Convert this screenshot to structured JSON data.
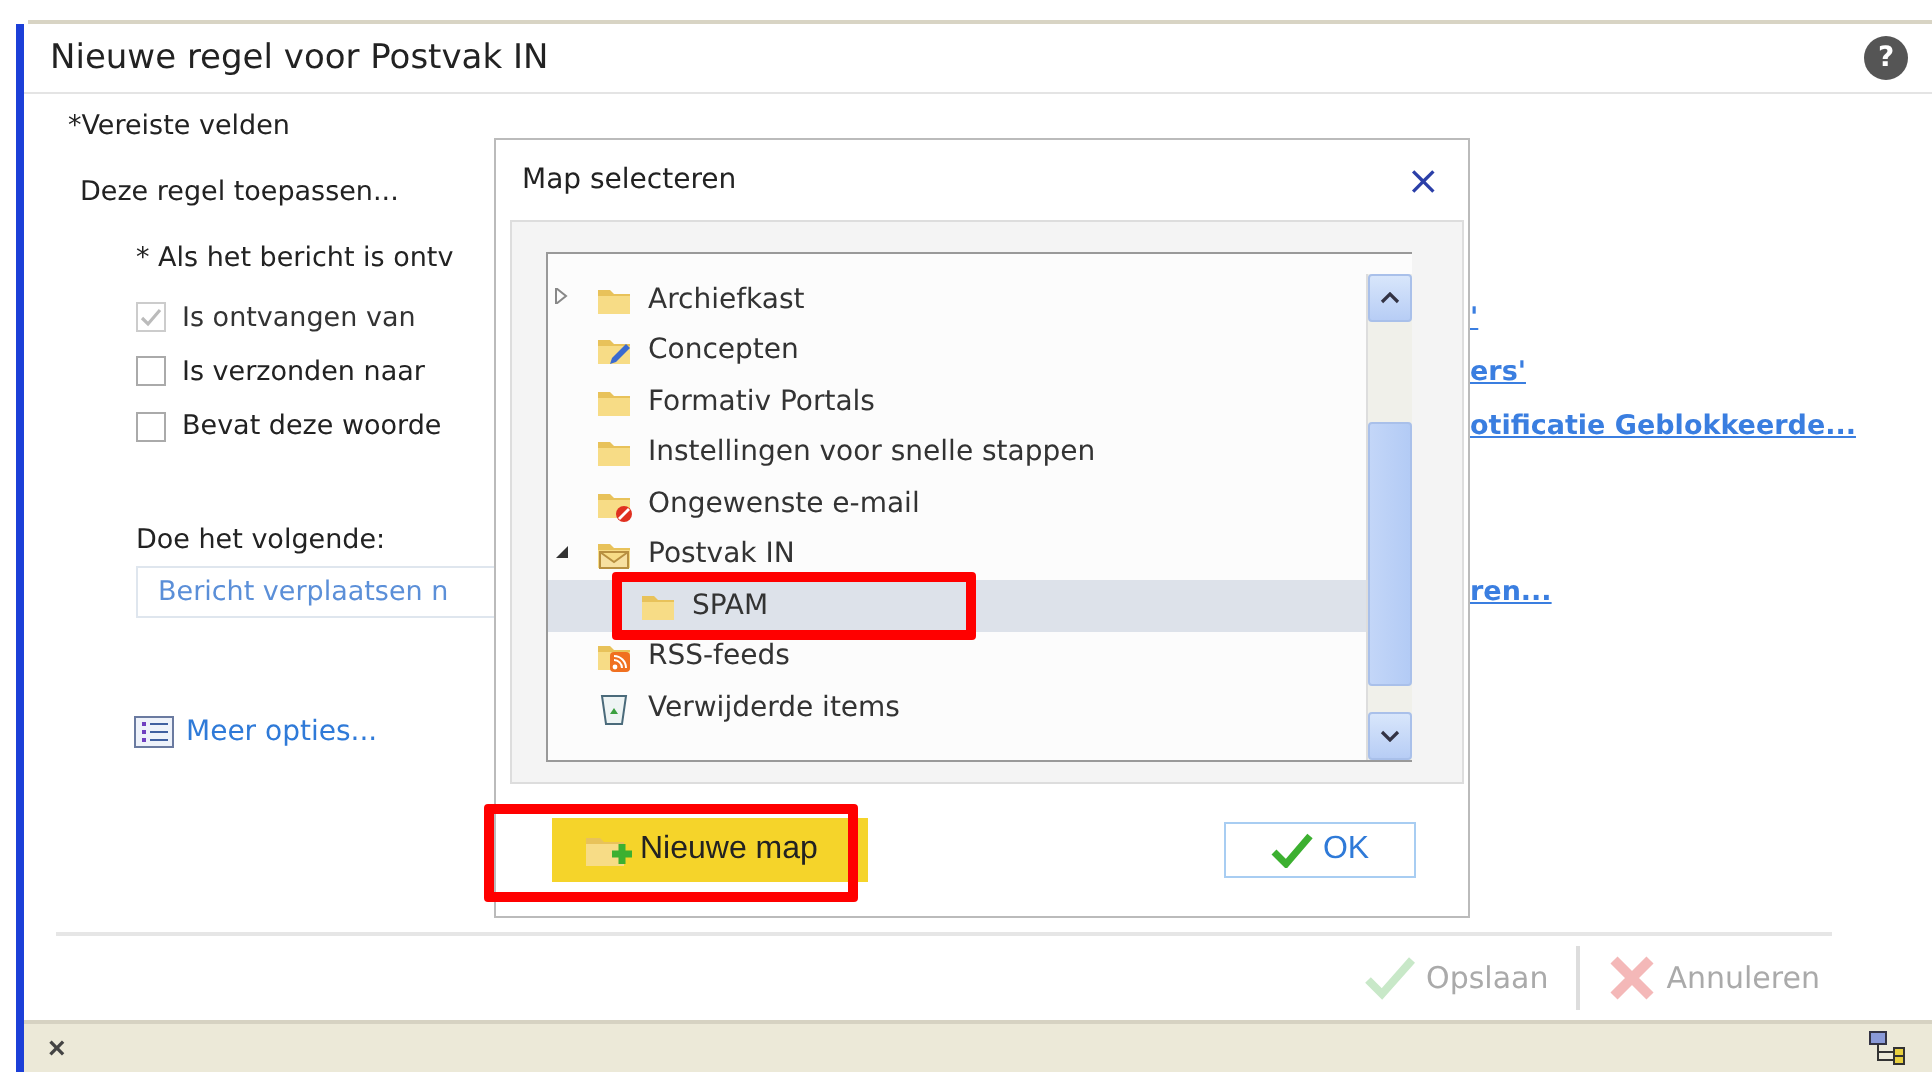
{
  "window": {
    "title": "Nieuwe regel voor Postvak IN",
    "help": "?"
  },
  "required_note": "*Vereiste velden",
  "apply_heading": "Deze regel toepassen...",
  "condition_heading": "* Als het bericht is ontv",
  "conditions": [
    {
      "label": "Is ontvangen van",
      "checked": true,
      "disabled": true,
      "link": "'"
    },
    {
      "label": "Is verzonden naar",
      "checked": false,
      "disabled": false,
      "link": "ers'"
    },
    {
      "label": "Bevat deze woorde",
      "checked": false,
      "disabled": false,
      "link": "otificatie Geblokkeerde..."
    }
  ],
  "action_heading": "Doe het volgende:",
  "action": {
    "value": "Bericht verplaatsen n",
    "link": "ren..."
  },
  "more_options": "Meer opties...",
  "footer_buttons": [
    {
      "label": "Opslaan",
      "kind": "save",
      "disabled": true
    },
    {
      "label": "Annuleren",
      "kind": "cancel",
      "disabled": true
    }
  ],
  "status_bar": {
    "close": "×"
  },
  "dialog": {
    "title": "Map selecteren",
    "close": "×",
    "folders": [
      {
        "label": "Archiefkast",
        "kind": "folder",
        "expanded": false,
        "selected": false
      },
      {
        "label": "Concepten",
        "kind": "drafts",
        "selected": false
      },
      {
        "label": "Formativ Portals",
        "kind": "folder",
        "selected": false
      },
      {
        "label": "Instellingen voor snelle stappen",
        "kind": "folder",
        "selected": false
      },
      {
        "label": "Ongewenste e-mail",
        "kind": "junk",
        "selected": false
      },
      {
        "label": "Postvak IN",
        "kind": "inbox",
        "expanded": true,
        "selected": false,
        "children": [
          {
            "label": "SPAM",
            "kind": "folder",
            "selected": true,
            "highlighted": true
          }
        ]
      },
      {
        "label": "RSS-feeds",
        "kind": "rss",
        "selected": false
      },
      {
        "label": "Verwijderde items",
        "kind": "trash",
        "selected": false
      }
    ],
    "buttons": [
      {
        "label": "Nieuwe map",
        "kind": "new-folder",
        "highlighted": true
      },
      {
        "label": "OK",
        "kind": "ok",
        "highlighted": false
      }
    ]
  }
}
